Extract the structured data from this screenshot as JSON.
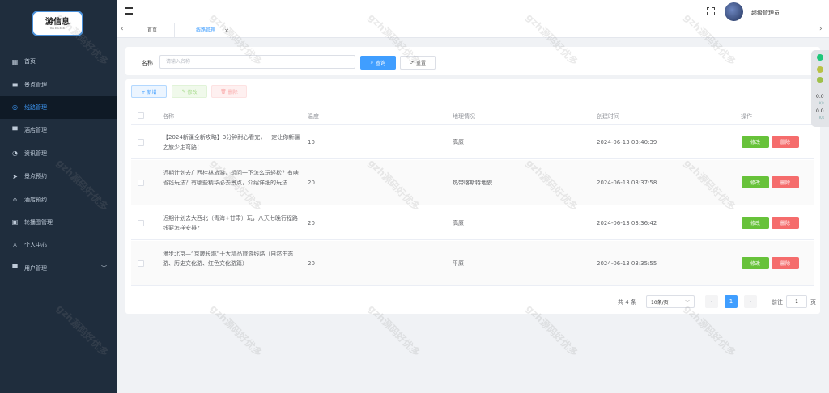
{
  "sidebar": {
    "logo_text": "游信息",
    "logo_sub": "You Xin Xi Xi",
    "items": [
      {
        "label": "首页",
        "icon": "grid-icon"
      },
      {
        "label": "景点管理",
        "icon": "ticket-icon"
      },
      {
        "label": "线路管理",
        "icon": "globe-icon"
      },
      {
        "label": "酒店管理",
        "icon": "monitor-icon"
      },
      {
        "label": "资讯管理",
        "icon": "gauge-icon"
      },
      {
        "label": "景点预约",
        "icon": "send-icon"
      },
      {
        "label": "酒店预约",
        "icon": "home-icon"
      },
      {
        "label": "轮播图管理",
        "icon": "image-icon"
      },
      {
        "label": "个人中心",
        "icon": "user-icon"
      },
      {
        "label": "用户管理",
        "icon": "monitor-icon"
      }
    ]
  },
  "header": {
    "user_name": "超级管理员"
  },
  "tabs": [
    {
      "label": "首页"
    },
    {
      "label": "线路管理",
      "close": "×"
    }
  ],
  "search": {
    "label": "名称",
    "placeholder": "请输入名称",
    "search_label": "查询",
    "reset_label": "重置"
  },
  "toolbar": {
    "add_label": "+ 新增",
    "edit_label": "修改",
    "delete_label": "删除"
  },
  "table": {
    "columns": [
      "名称",
      "温度",
      "地理情况",
      "创建时间",
      "操作"
    ],
    "rows": [
      {
        "name": "【2024新疆全新攻略】3分钟耐心看完，一定让你新疆之旅少走弯路！",
        "temp": "10",
        "geo": "高原",
        "time": "2024-06-13 03:40:39"
      },
      {
        "name": "近期计划去广西桂林旅游，想问一下怎么玩轻松？有啥省钱玩法？有哪些精华必去景点，介绍详细的玩法",
        "temp": "20",
        "geo": "热带喀斯特地貌",
        "time": "2024-06-13 03:37:58"
      },
      {
        "name": "近期计划去大西北（青海+甘肃）玩，八天七晚行程路线要怎样安排?",
        "temp": "20",
        "geo": "高原",
        "time": "2024-06-13 03:36:42"
      },
      {
        "name": "漫步北京—“京畿长城”十大精品旅游线路（自然生态游、历史文化游、红色文化游篇）",
        "temp": "20",
        "geo": "平原",
        "time": "2024-06-13 03:35:55"
      }
    ],
    "row_edit": "修改",
    "row_delete": "删除"
  },
  "pagination": {
    "total": "共 4 条",
    "page_size": "10条/页",
    "current": "1",
    "goto_label": "前往",
    "goto_value": "1",
    "page_unit": "页"
  },
  "widget": {
    "v1": "0.0",
    "s1": "K/s",
    "v2": "0.0",
    "s2": "K/s"
  },
  "watermark": "gzh源码好优多",
  "colors": {
    "primary": "#409eff",
    "success": "#67c23a",
    "danger": "#f56c6c",
    "sidebar": "#1f2d3d"
  }
}
